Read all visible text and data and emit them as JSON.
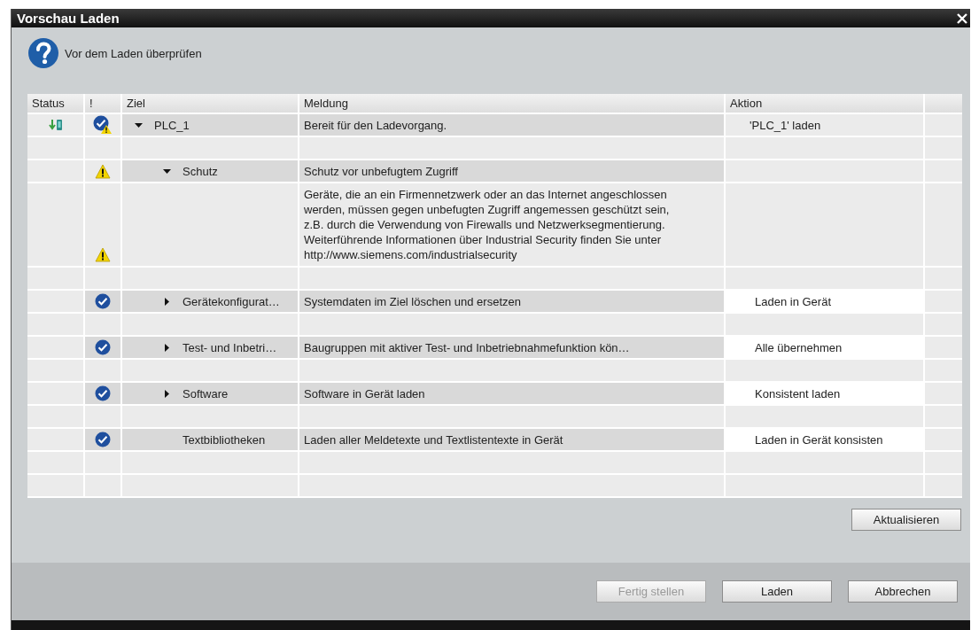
{
  "window": {
    "title": "Vorschau Laden"
  },
  "header": {
    "text": "Vor dem Laden überprüfen"
  },
  "table": {
    "columns": [
      "Status",
      "!",
      "Ziel",
      "Meldung",
      "Aktion"
    ],
    "rows": [
      {
        "kind": "item",
        "status": {
          "kind": "download"
        },
        "check": {
          "kind": "ok_warning"
        },
        "target": "PLC_1",
        "expanded": true,
        "message": "Bereit für den Ladevorgang.",
        "action": "'PLC_1' laden",
        "editable": false,
        "children": [
          {
            "kind": "item",
            "check": {
              "kind": "warning"
            },
            "target": "Schutz",
            "expanded": true,
            "message": "Schutz vor unbefugtem Zugriff",
            "children": [
              {
                "kind": "detail",
                "check": {
                  "kind": "warning"
                },
                "message": "Geräte, die an ein Firmennetzwerk oder an das Internet angeschlossen werden, müssen gegen unbefugten Zugriff angemessen geschützt sein, z.B. durch die Verwendung von Firewalls und Netzwerksegmentierung. Weiterführende Informationen über Industrial Security finden Sie unter http://www.siemens.com/industrialsecurity"
              }
            ]
          },
          {
            "kind": "item",
            "check": {
              "kind": "ok"
            },
            "target": "Gerätekonfigurat…",
            "expanded": false,
            "message": "Systemdaten im Ziel löschen und ersetzen",
            "action": "Laden in Gerät",
            "editable": true
          },
          {
            "kind": "item",
            "check": {
              "kind": "ok"
            },
            "target": "Test- und Inbetri…",
            "expanded": false,
            "message": "Baugruppen mit aktiver Test- und Inbetriebnahmefunktion kön…",
            "action": "Alle übernehmen",
            "editable": true
          },
          {
            "kind": "item",
            "check": {
              "kind": "ok"
            },
            "target": "Software",
            "expanded": false,
            "message": "Software in Gerät laden",
            "action": "Konsistent laden",
            "editable": true
          },
          {
            "kind": "item",
            "check": {
              "kind": "ok"
            },
            "target": "Textbibliotheken",
            "message": "Laden aller Meldetexte und Textlistentexte in Gerät",
            "action": "Laden in Gerät konsisten",
            "editable": true
          }
        ]
      }
    ]
  },
  "refresh_button": {
    "label": "Aktualisieren"
  },
  "buttons": [
    {
      "label": "Fertig stellen",
      "disabled": true
    },
    {
      "label": "Laden",
      "disabled": false
    },
    {
      "label": "Abbrechen",
      "disabled": false
    }
  ]
}
